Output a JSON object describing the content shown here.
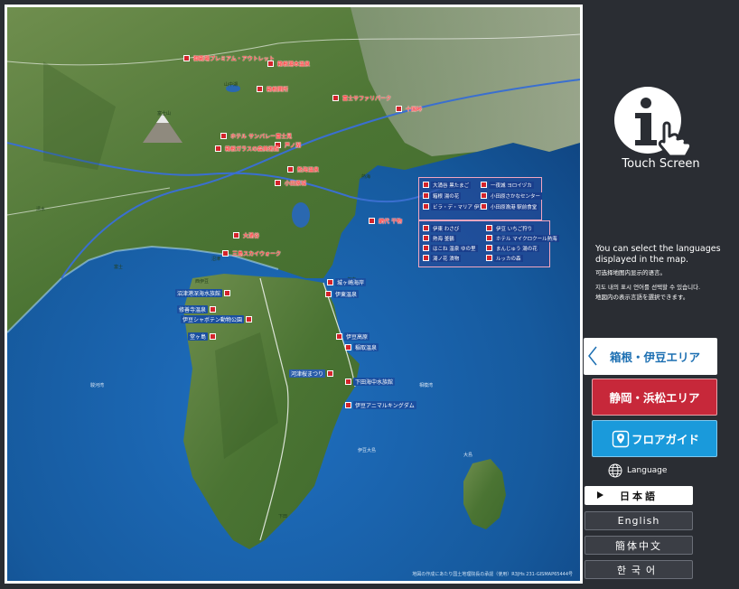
{
  "map": {
    "copyright": "地図の作成にあたり国土地理院長の承認（使用）R3JHs 231-GISMAP65444号",
    "place_names": [
      "富士山",
      "山中湖",
      "駿河湾",
      "相模湾",
      "清水",
      "富士",
      "沼津",
      "熱海",
      "伊東",
      "下田",
      "大島",
      "伊豆大島",
      "西伊豆"
    ],
    "pois_red": [
      "御殿場プレミアム・アウトレット",
      "箱根湯本温泉",
      "箱根関所",
      "富士サファリパーク",
      "十国峠",
      "ホテル サンバレー富士見",
      "芦ノ湖",
      "箱根ガラスの森美術館",
      "熱海温泉",
      "小田原城",
      "大涌谷",
      "三島スカイウォーク"
    ],
    "pois_blue": [
      "沼津港深海水族館",
      "修善寺温泉",
      "伊豆シャボテン動物公園",
      "城ヶ崎海岸",
      "伊東温泉",
      "伊豆高原",
      "稲取温泉",
      "河津桜まつり",
      "下田海中水族館",
      "伊豆アニマルキングダム",
      "堂ヶ島"
    ],
    "callout": [
      "大涌谷 黒たまご",
      "一夜城 ヨロイヅカ",
      "箱根 湯の花",
      "小田原さかなセンター",
      "ビラ・デ・マリア 伊豆",
      "小田原漁港 駅前食堂",
      "伊東 わさび",
      "伊豆 いちご狩り",
      "熱海 釜鶴",
      "網代 干物",
      "ホテル マイクロクール熱海",
      "はこね 温泉 ゆの里",
      "まんじゅう 湯の花",
      "湯ノ花 漬物",
      "ルッカの森"
    ]
  },
  "panel": {
    "touch_label": "Touch Screen",
    "instruction_en": "You can select the languages displayed in the map.",
    "instruction_zh": "可选择地图内显示的语言。",
    "instruction_ko": "지도 내의 표시 언어를 선택할 수 있습니다.",
    "instruction_ja": "地図内の表示言語を選択できます。",
    "area_buttons": {
      "hakone": "箱根・伊豆エリア",
      "shizuoka": "静岡・浜松エリア",
      "floor": "フロアガイド"
    },
    "language_title": "Language",
    "languages": {
      "japanese": "日本語",
      "english": "English",
      "chinese": "簡体中文",
      "korean": "한국어"
    },
    "selected_language": "日本語"
  },
  "colors": {
    "panel_bg": "#2a2d33",
    "hakone_text": "#1c6fb2",
    "shizuoka_bg": "#c7283a",
    "floor_bg": "#1a9adb",
    "sea": "#1b5ea8",
    "land": "#4f7a3a",
    "poi_red": "#d3242b"
  }
}
